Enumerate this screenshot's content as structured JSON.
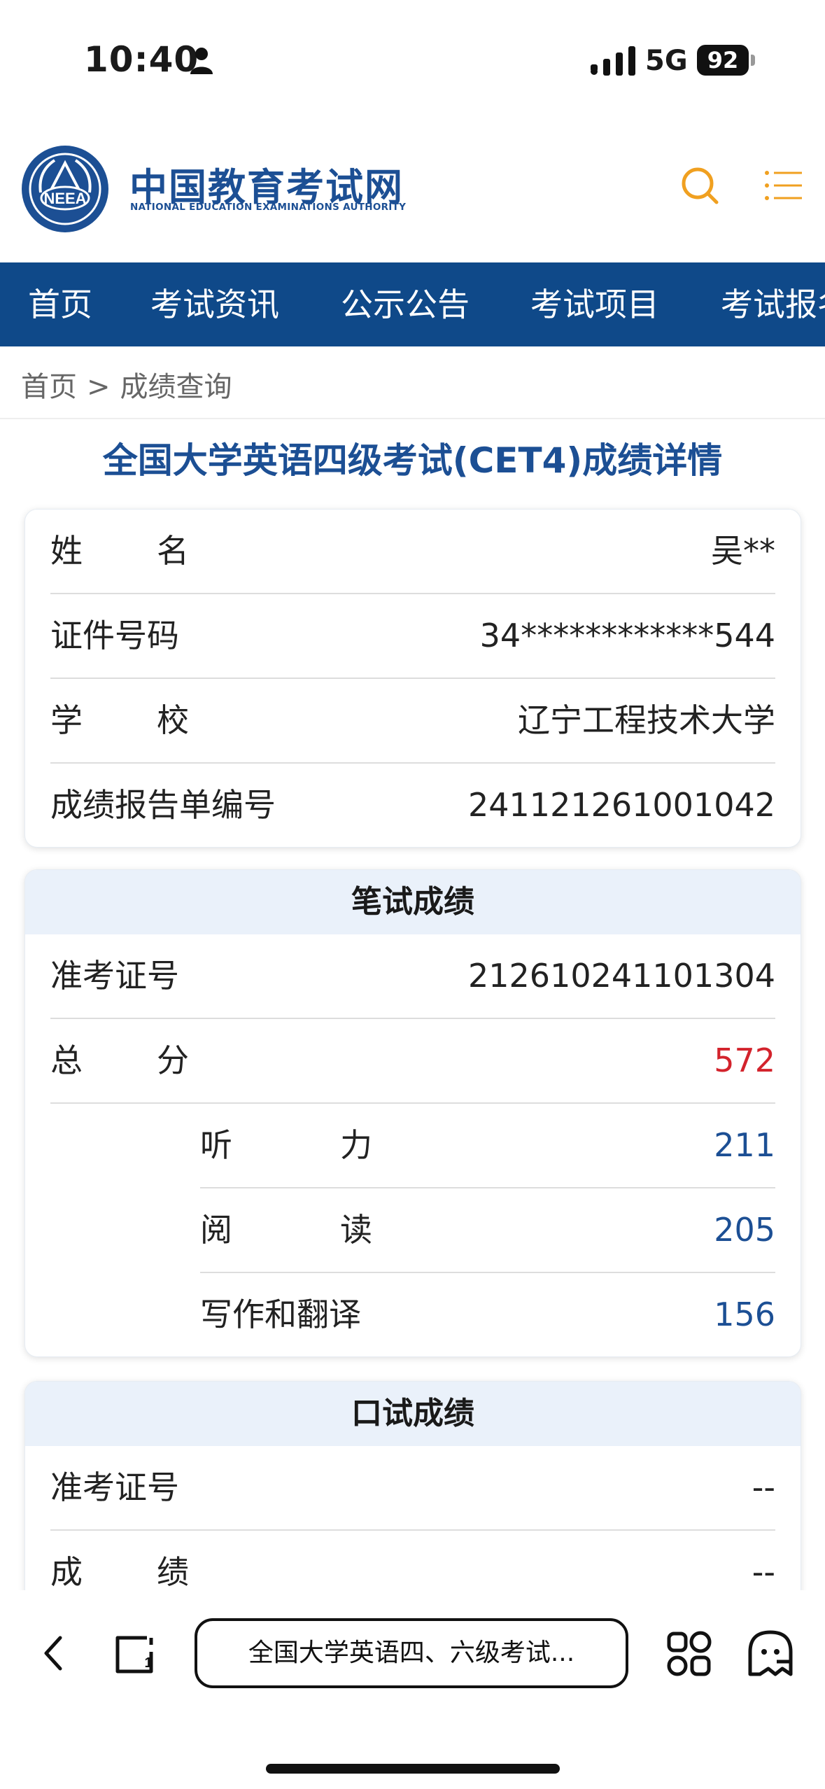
{
  "status_bar": {
    "time": "10:40",
    "network": "5G",
    "battery": "92"
  },
  "header": {
    "logo_text": "中国教育考试网",
    "logo_subtitle": "NATIONAL EDUCATION EXAMINATIONS AUTHORITY",
    "logo_mark": "NEEA"
  },
  "nav": {
    "items": [
      "首页",
      "考试资讯",
      "公示公告",
      "考试项目",
      "考试报名"
    ]
  },
  "breadcrumb": {
    "home": "首页",
    "separator": ">",
    "current": "成绩查询"
  },
  "page_title": "全国大学英语四级考试(CET4)成绩详情",
  "personal": {
    "name_label": [
      "姓",
      "名"
    ],
    "name_value": "吴**",
    "id_label": "证件号码",
    "id_value": "34************544",
    "school_label": [
      "学",
      "校"
    ],
    "school_value": "辽宁工程技术大学",
    "report_label": "成绩报告单编号",
    "report_value": "241121261001042"
  },
  "written": {
    "title": "笔试成绩",
    "ticket_label": "准考证号",
    "ticket_value": "212610241101304",
    "total_label": [
      "总",
      "分"
    ],
    "total_value": "572",
    "listening_label": [
      "听",
      "力"
    ],
    "listening_value": "211",
    "reading_label": [
      "阅",
      "读"
    ],
    "reading_value": "205",
    "writing_label": "写作和翻译",
    "writing_value": "156"
  },
  "oral": {
    "title": "口试成绩",
    "ticket_label": "准考证号",
    "ticket_value": "--",
    "score_label": [
      "成",
      "绩"
    ],
    "score_value": "--"
  },
  "toolbar": {
    "url_text": "全国大学英语四、六级考试..."
  },
  "colors": {
    "brand": "#1c4f94",
    "nav_bg": "#0f4989",
    "total_red": "#d3232c",
    "card_head_bg": "#eaf1fa",
    "accent_orange": "#f0a020"
  }
}
